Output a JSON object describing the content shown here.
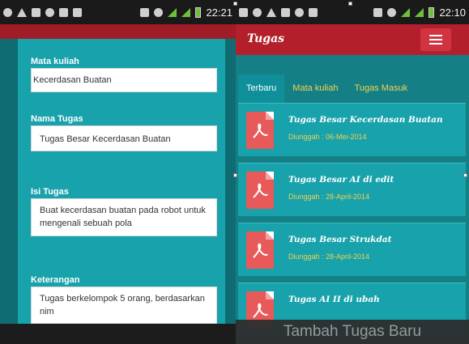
{
  "left_screen": {
    "status_bar": {
      "time": "22:21"
    },
    "form": {
      "fields": [
        {
          "label": "Mata kuliah",
          "value": "Kecerdasan Buatan"
        },
        {
          "label": "Nama Tugas",
          "value": "Tugas Besar Kecerdasan Buatan"
        },
        {
          "label": "Isi Tugas",
          "value": "Buat kecerdasan buatan pada robot untuk mengenali sebuah pola"
        },
        {
          "label": "Keterangan",
          "value": "Tugas berkelompok 5 orang, berdasarkan nim"
        }
      ]
    }
  },
  "right_screen": {
    "status_bar": {
      "time": "22:10"
    },
    "app_title": "Tugas",
    "tabs": [
      {
        "label": "Terbaru",
        "active": true
      },
      {
        "label": "Mata kuliah",
        "active": false
      },
      {
        "label": "Tugas Masuk",
        "active": false
      }
    ],
    "assignments": [
      {
        "title": "Tugas Besar Kecerdasan Buatan",
        "date": "Diunggah : 06-Mei-2014"
      },
      {
        "title": "Tugas Besar AI di edit",
        "date": "Diunggah : 28-April-2014"
      },
      {
        "title": "Tugas Besar Strukdat",
        "date": "Diunggah : 28-April-2014"
      },
      {
        "title": "Tugas AI II di ubah",
        "date": ""
      }
    ],
    "add_button_label": "Tambah Tugas Baru"
  },
  "colors": {
    "teal": "#18a2ab",
    "dark_teal": "#157f86",
    "header_red": "#b3202b",
    "accent_yellow": "#f2d250",
    "pdf_red": "#e85a5a"
  },
  "icons": {
    "menu": "hamburger-menu-icon",
    "file": "pdf-file-icon"
  }
}
